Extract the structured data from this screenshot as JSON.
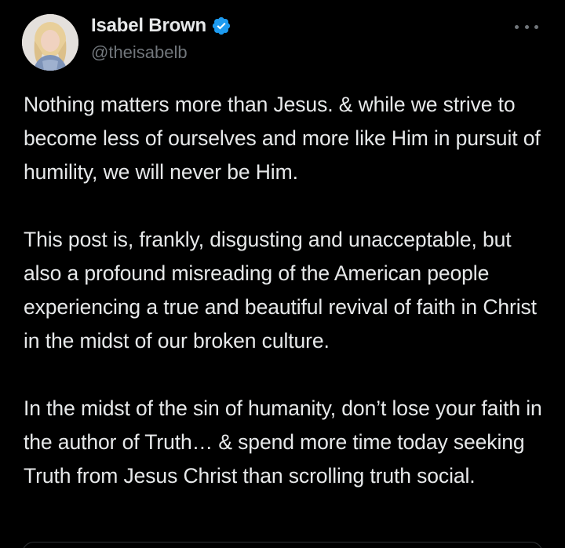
{
  "tweet": {
    "author": {
      "display_name": "Isabel Brown",
      "handle": "@theisabelb",
      "verified": true,
      "verified_color": "#1d9bf0"
    },
    "more_icon": "ellipsis-icon",
    "paragraphs": [
      "Nothing matters more than Jesus. & while we strive to become less of ourselves and more like Him in pursuit of humility, we will never be Him.",
      "This post is, frankly, disgusting and unacceptable, but also a profound misreading of the American people experiencing a true and beautiful revival of faith in Christ in the midst of our broken culture.",
      "In the midst of the sin of humanity, don’t lose your faith in the author of Truth… & spend more time today seeking Truth from Jesus Christ than scrolling truth social."
    ]
  },
  "colors": {
    "background": "#000000",
    "text_primary": "#e7e9ea",
    "text_secondary": "#71767b",
    "accent": "#1d9bf0"
  }
}
